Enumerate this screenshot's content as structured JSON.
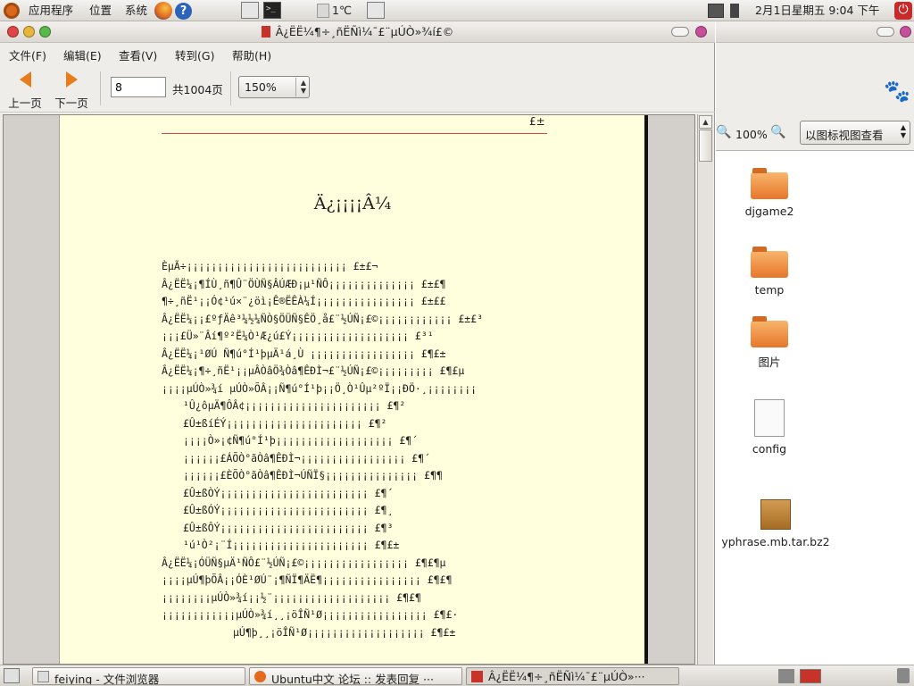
{
  "top_panel": {
    "menus": [
      "应用程序",
      "位置",
      "系统"
    ],
    "temperature": "1℃",
    "clock": "2月1日星期五  9:04 下午"
  },
  "window": {
    "title": "Â¿ËË¼¶÷¸ñËÑì¼¯£¨µÚÒ»¾í£©",
    "menus": [
      "文件(F)",
      "编辑(E)",
      "查看(V)",
      "转到(G)",
      "帮助(H)"
    ],
    "toolbar": {
      "prev_label": "上一页",
      "next_label": "下一页",
      "page_value": "8",
      "page_total": "共1004页",
      "zoom": "150%"
    }
  },
  "document": {
    "header_number": "£±",
    "title": "Ä¿¡¡¡¡Â¼",
    "toc": [
      {
        "text": "ÈµÃ÷¡­¡­¡­¡­¡­¡­¡­¡­¡­¡­¡­¡­¡­¡­¡­¡­¡­¡­¡­¡­¡­¡­¡­¡­¡­¡­ £±£¬",
        "indent": 0
      },
      {
        "text": "Â¿ËË¼¡¶ÍÙ¸ñ¶Û¨ÖÙÑ§ÂÚÆÐ¡µ¹ÑÔ¡­¡­¡­¡­¡­¡­¡­¡­¡­¡­¡­¡­¡­¡­ £±£¶",
        "indent": 0
      },
      {
        "text": "¶÷¸ñË¹¡¡Ó¢¹ú×¨¿öì¡Ê®ËÊÀ¼Í¡­¡­¡­¡­¡­¡­¡­¡­¡­¡­¡­¡­¡­¡­¡­¡­ £±££",
        "indent": 0
      },
      {
        "text": "Â¿ËË¼¡¡£ºƒÄê³¼½¼ÑÒ§ÖÜÑ§ÊÖ¸å£¨½ÚÑ¡£©¡­¡­¡­¡­¡­¡­¡­¡­¡­¡­¡­¡­ £±£³",
        "indent": 0
      },
      {
        "text": "¡¡¡£Ü­»¨Âí¶º²Ë¼Ò¹Æ¿ú£Ý¡­¡­¡­¡­¡­¡­¡­¡­¡­¡­¡­¡­¡­¡­¡­¡­¡­¡­¡­ £³¹",
        "indent": 0
      },
      {
        "text": "Â¿ËË¼¡¹ØÚ Ñ¶ú°Í¹þµÄ¹á¸Ù ¡­¡­¡­¡­¡­¡­¡­¡­¡­¡­¡­¡­¡­¡­¡­¡­¡­ £¶£±",
        "indent": 0
      },
      {
        "text": "Â¿ËË¼¡¶÷¸ñË¹¡¡µÂÒâÖ¾Òâ¶ÊÐÌ¬£¨½ÚÑ¡£©¡­¡­¡­¡­¡­¡­¡­¡­¡­ £¶£µ",
        "indent": 0
      },
      {
        "text": "¡¡¡¡µÚÒ»¾í µÚÒ»ÕÂ¡¡Ñ¶ú°Í¹þ¡¡Ö¸Ò¹Ûµ²ºÏ¡¡ÐÖ·¸¡­¡­¡­¡­¡­¡­¡­¡­",
        "indent": 0
      },
      {
        "text": "¹Û¿ôµÄ¶ÔÂ¢¡­¡­¡­¡­¡­¡­¡­¡­¡­¡­¡­¡­¡­¡­¡­¡­¡­¡­¡­¡­¡­¡­ £¶²",
        "indent": 24
      },
      {
        "text": "£Û±ßíÉÝ¡­¡­¡­¡­¡­¡­¡­¡­¡­¡­¡­¡­¡­¡­¡­¡­¡­¡­¡­¡­¡­¡­ £¶²",
        "indent": 24
      },
      {
        "text": "¡¡¡¡Ò»¡¢Ñ¶ú°Í¹þ¡­¡­¡­¡­¡­¡­¡­¡­¡­¡­¡­¡­¡­¡­¡­¡­¡­¡­¡­ £¶´",
        "indent": 24
      },
      {
        "text": "¡¡¡¡¡¡£ÁÕÒ°ãÒâ¶ÊÐÌ¬¡­¡­¡­¡­¡­¡­¡­¡­¡­¡­¡­¡­¡­¡­¡­¡­¡­ £¶´",
        "indent": 24
      },
      {
        "text": "¡¡¡¡¡¡£ÈÕÒ°ãÒâ¶ÊÐÌ¬ÚÑÏ§¡­¡­¡­¡­¡­¡­¡­¡­¡­¡­¡­¡­¡­¡­¡­ £¶¶",
        "indent": 24
      },
      {
        "text": "£Û±ßÒÝ¡­¡­¡­¡­¡­¡­¡­¡­¡­¡­¡­¡­¡­¡­¡­¡­¡­¡­¡­¡­¡­¡­¡­¡­ £¶´",
        "indent": 24
      },
      {
        "text": "£Û±ßÓÝ¡­¡­¡­¡­¡­¡­¡­¡­¡­¡­¡­¡­¡­¡­¡­¡­¡­¡­¡­¡­¡­¡­¡­¡­ £¶¸",
        "indent": 24
      },
      {
        "text": "£Û±ßÔÝ¡­¡­¡­¡­¡­¡­¡­¡­¡­¡­¡­¡­¡­¡­¡­¡­¡­¡­¡­¡­¡­¡­¡­¡­ £¶³",
        "indent": 24
      },
      {
        "text": "¹ú¹Ò²¡¨Í¡­¡­¡­¡­¡­¡­¡­¡­¡­¡­¡­¡­¡­¡­¡­¡­¡­¡­¡­¡­¡­¡­ £¶£±",
        "indent": 24
      },
      {
        "text": "Â¿ËË¼¡ÓÜÑ§µÄ¹ÑÔ£¨½ÚÑ¡£©¡­¡­¡­¡­¡­¡­¡­¡­¡­¡­¡­¡­¡­¡­¡­¡­¡­ £¶£¶µ",
        "indent": 0
      },
      {
        "text": "¡¡¡¡µÚ¶þÕÂ¡¡ÓÈ¹ØÚ¨¡¶ÑÏ¶ÄË¶¡­¡­¡­¡­¡­¡­¡­¡­¡­¡­¡­¡­¡­¡­¡­¡­ £¶£¶",
        "indent": 0
      },
      {
        "text": "¡¡¡¡¡¡¡¡µÚÒ»¾í¡¡½¨¡­¡­¡­¡­¡­¡­¡­¡­¡­¡­¡­¡­¡­¡­¡­¡­¡­¡­¡­ £¶£¶",
        "indent": 0
      },
      {
        "text": "¡¡¡¡¡¡¡¡¡¡¡¡µÚÒ»¾í¸¸¡öÎÑ¹Ø¡­¡­¡­¡­¡­¡­¡­¡­¡­¡­¡­¡­¡­¡­¡­¡­¡­ £¶£·",
        "indent": 0
      },
      {
        "text": "µÚ¶þ¸¸¡öÎÑ¹Ø¡­¡­¡­¡­¡­¡­¡­¡­¡­¡­¡­¡­¡­¡­¡­¡­¡­¡­¡­ £¶£±",
        "indent": 80
      }
    ]
  },
  "file_browser": {
    "zoom": "100%",
    "view_mode": "以图标视图查看",
    "files": [
      {
        "name": "djgame2",
        "type": "folder"
      },
      {
        "name": "temp",
        "type": "folder"
      },
      {
        "name": "图片",
        "type": "folder"
      },
      {
        "name": "config",
        "type": "document"
      },
      {
        "name": "yphrase.mb.tar.bz2",
        "type": "archive"
      }
    ]
  },
  "taskbar": {
    "tasks": [
      {
        "label": "feiying - 文件浏览器",
        "icon": "folder-icon"
      },
      {
        "label": "Ubuntu中文 论坛 :: 发表回复 ···",
        "icon": "firefox-icon"
      },
      {
        "label": "Â¿ËË¼¶÷¸ñËÑì¼¯£¨µÚÒ»···",
        "icon": "document-viewer-icon"
      }
    ]
  },
  "colors": {
    "page_background": "#ffffdd",
    "header_rule": "#dd4444",
    "accent_orange": "#e77d1a"
  }
}
